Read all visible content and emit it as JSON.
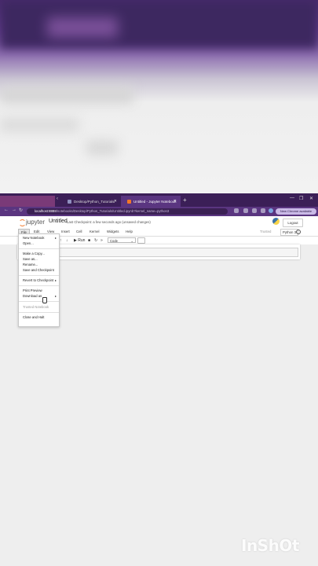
{
  "browser": {
    "tabs": [
      {
        "label": "Desktop/Python_Tutorials/",
        "active": false
      },
      {
        "label": "Untitled - Jupyter Notebook",
        "active": true
      }
    ],
    "url_host": "localhost:8888",
    "url_path": "/notebooks/Desktop/Python_Tutorials/Untitled.ipynb?kernel_name=python3",
    "chrome_button": "New Chrome available"
  },
  "jupyter": {
    "logo": "jupyter",
    "notebook_title": "Untitled",
    "checkpoint": "Last Checkpoint: a few seconds ago",
    "unsaved": "(unsaved changes)",
    "logout": "Logout",
    "trusted": "Trusted",
    "kernel": "Python 3"
  },
  "menubar": [
    "File",
    "Edit",
    "View",
    "Insert",
    "Cell",
    "Kernel",
    "Widgets",
    "Help"
  ],
  "toolbar": {
    "run": "Run",
    "cell_type": "Code"
  },
  "file_menu": {
    "new_notebook": "New Notebook",
    "open": "Open...",
    "make_copy": "Make a Copy...",
    "save_as": "Save as...",
    "rename": "Rename...",
    "save_checkpoint": "Save and Checkpoint",
    "revert": "Revert to Checkpoint",
    "print_preview": "Print Preview",
    "download_as": "Download as",
    "trusted_notebook": "Trusted Notebook",
    "close_halt": "Close and Halt"
  },
  "watermark": "InShOt",
  "colors": {
    "tab_bar": "#3b1f57",
    "address_bar": "#5a3580",
    "jupyter_orange": "#f37726"
  }
}
